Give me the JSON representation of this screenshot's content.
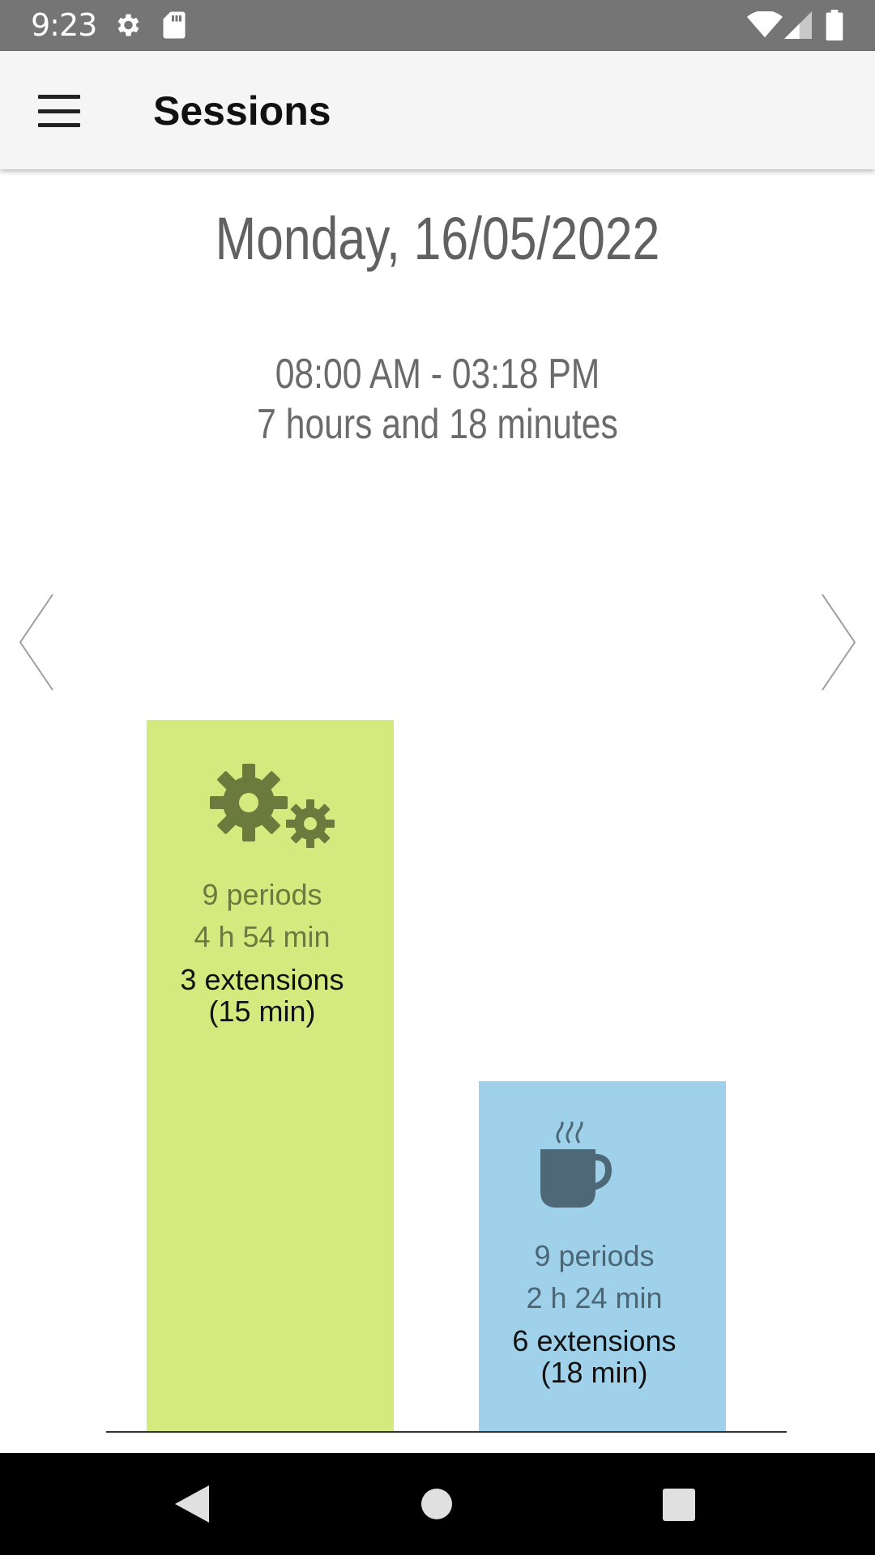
{
  "status_bar": {
    "time": "9:23",
    "icons": [
      "gear-icon",
      "sd-card-icon",
      "wifi-icon",
      "signal-icon",
      "battery-icon"
    ]
  },
  "app_bar": {
    "title": "Sessions",
    "menu_icon": "hamburger-menu-icon"
  },
  "session": {
    "date": "Monday, 16/05/2022",
    "time_range": "08:00 AM - 03:18 PM",
    "duration": "7 hours and 18 minutes"
  },
  "navigation": {
    "prev_icon": "chevron-left-icon",
    "next_icon": "chevron-right-icon"
  },
  "bars": {
    "work": {
      "icon": "gears-icon",
      "color": "#d4ea7e",
      "periods": "9 periods",
      "duration": "4 h 54 min",
      "extensions_line1": "3 extensions",
      "extensions_line2": "(15 min)"
    },
    "break": {
      "icon": "coffee-mug-icon",
      "color": "#9fd2ea",
      "periods": "9 periods",
      "duration": "2 h 24 min",
      "extensions_line1": "6 extensions",
      "extensions_line2": "(18 min)"
    }
  },
  "system_nav": {
    "back": "back-icon",
    "home": "home-icon",
    "recents": "recents-icon"
  }
}
